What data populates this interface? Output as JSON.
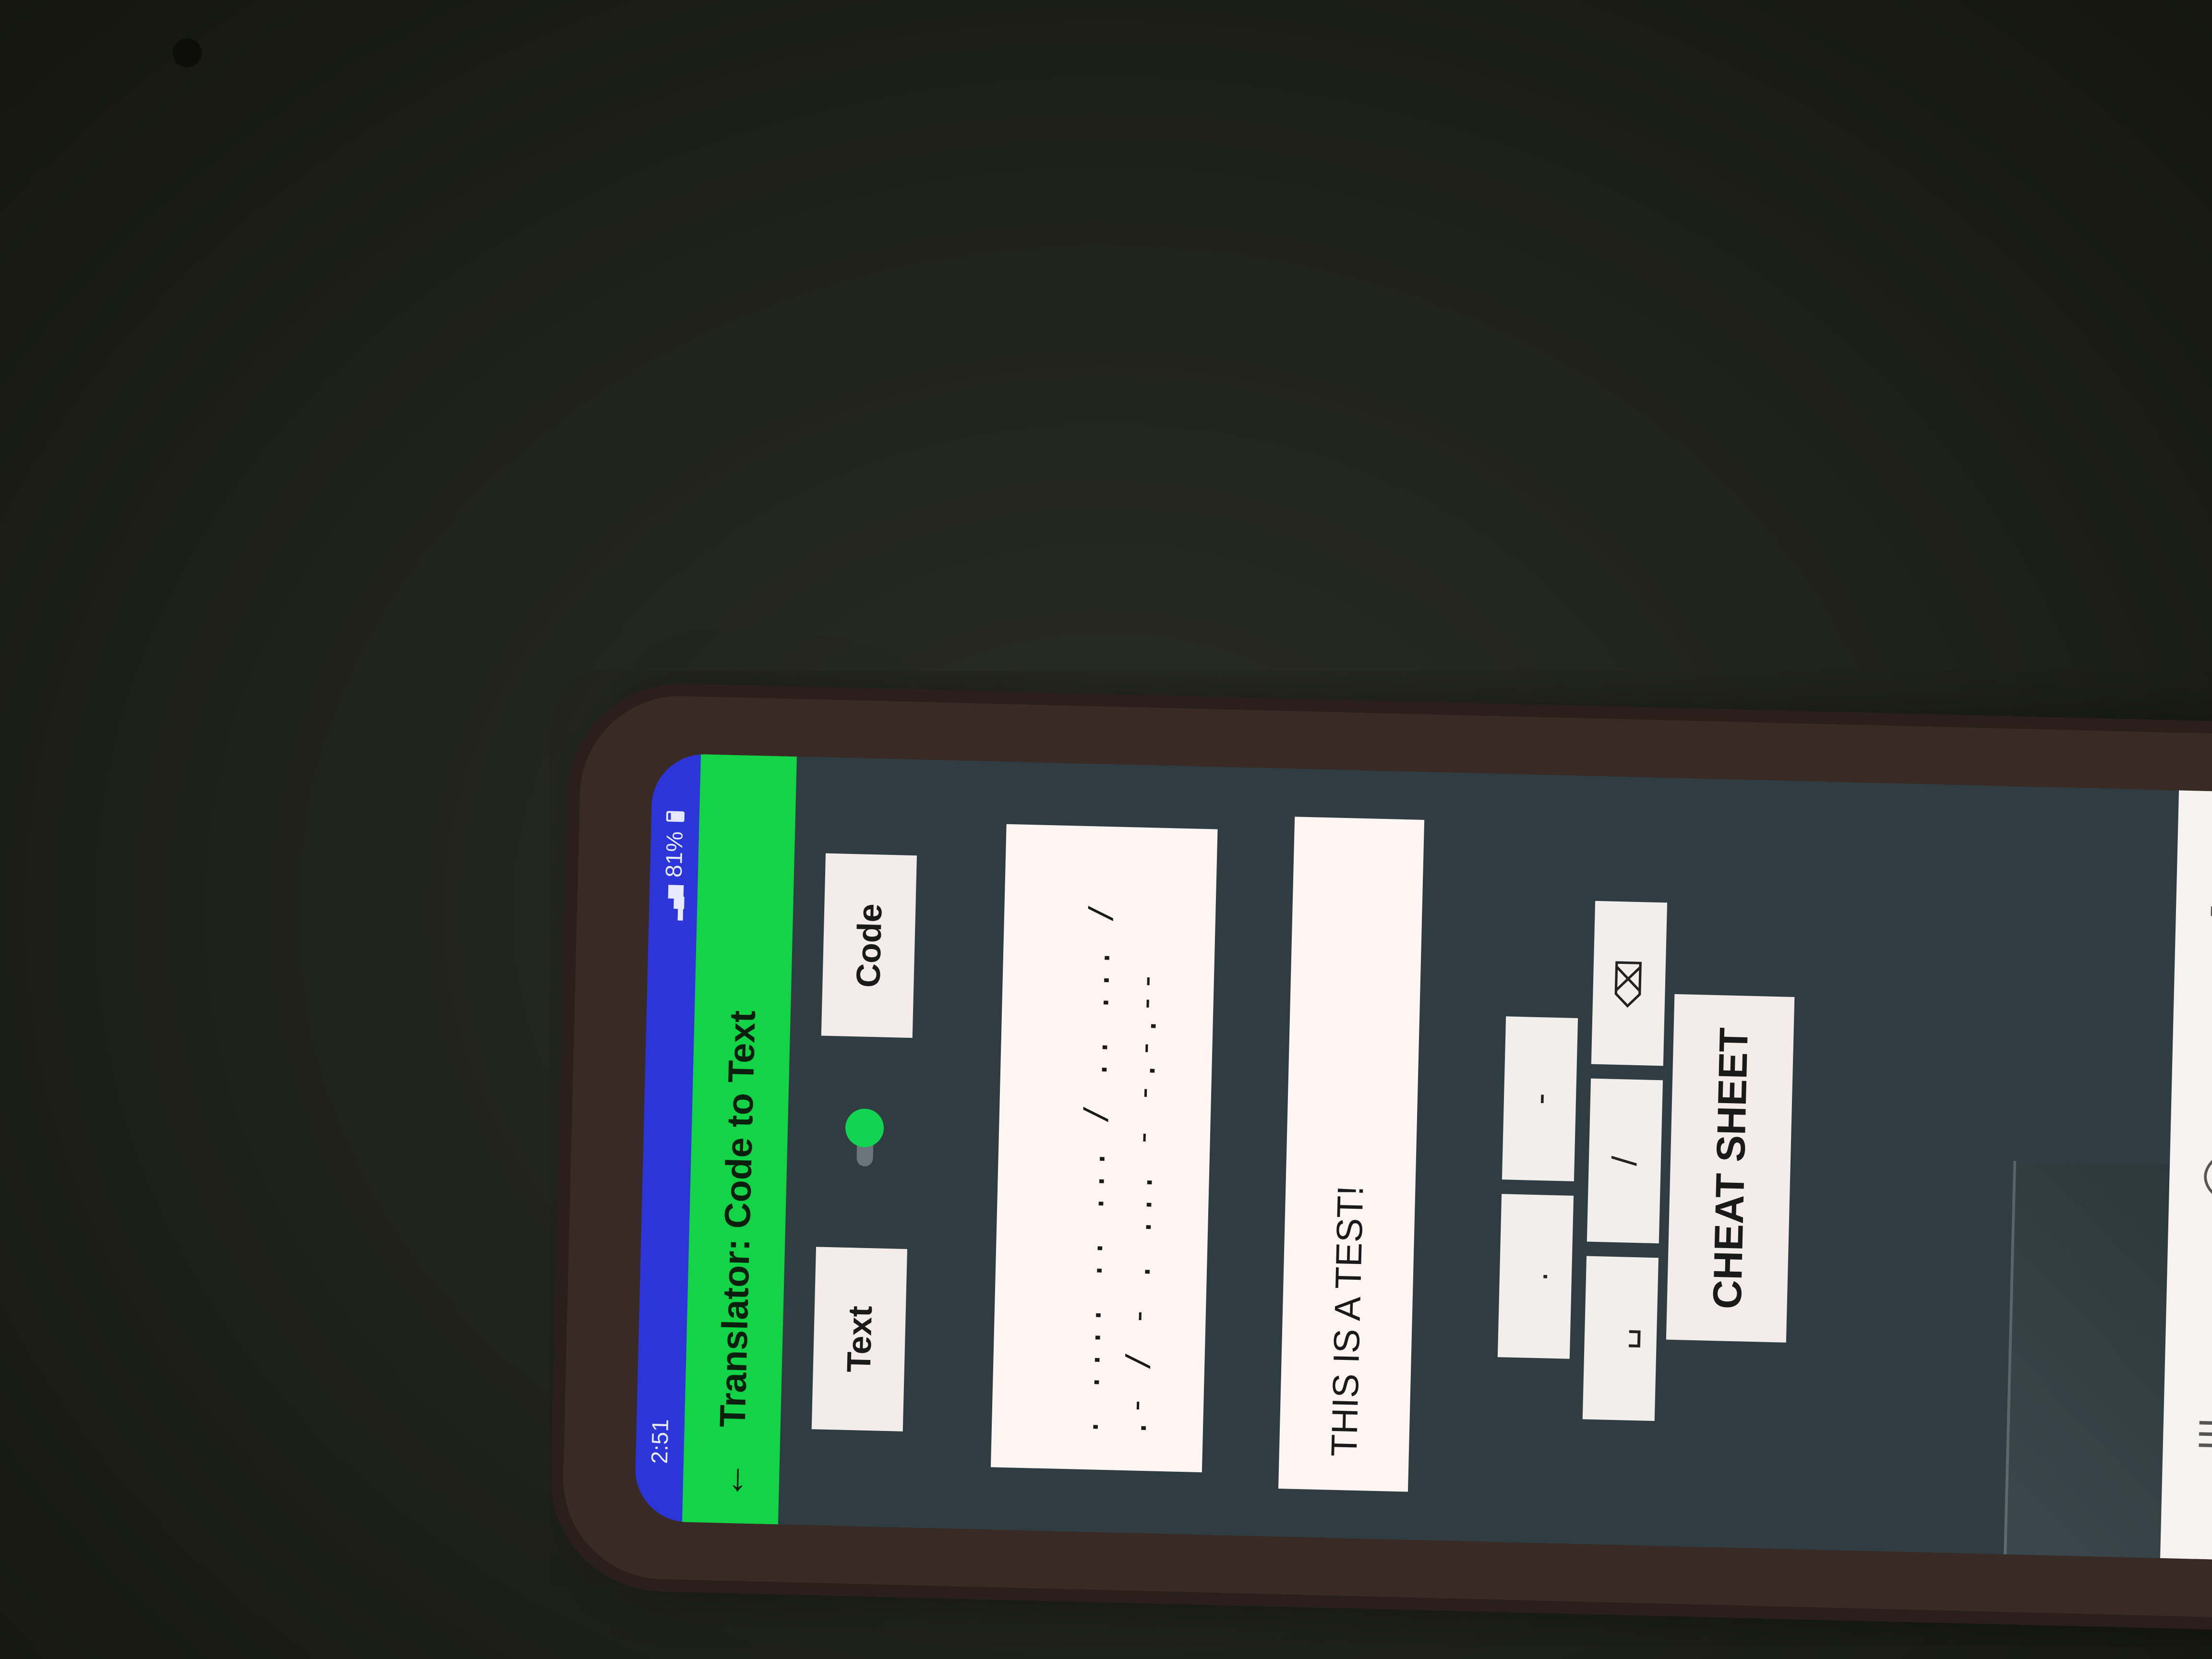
{
  "status_bar": {
    "time": "2:51",
    "battery": "81%"
  },
  "app_bar": {
    "title": "Translator: Code to Text"
  },
  "mode": {
    "text_label": "Text",
    "code_label": "Code",
    "switch_on": true
  },
  "code_output": ". .... .. ... / .. ... / .- / - . ... - -.-.--",
  "text_output": "THIS IS A TEST!",
  "keypad": {
    "dot": ".",
    "dash": "-",
    "space": "␣",
    "slash": "/",
    "backspace": "⌫"
  },
  "cheat_sheet_label": "CHEAT SHEET",
  "nav": {
    "recents": "|||",
    "home": "◯",
    "back": "❮"
  },
  "colors": {
    "status_bar": "#2b35d8",
    "app_bar": "#12d446",
    "screen_background": "#2f3d42",
    "switch_thumb": "#13d452"
  },
  "icons": [
    "back-arrow-icon",
    "signal-icon",
    "battery-icon",
    "backspace-icon",
    "recents-icon",
    "home-icon",
    "nav-back-icon"
  ]
}
